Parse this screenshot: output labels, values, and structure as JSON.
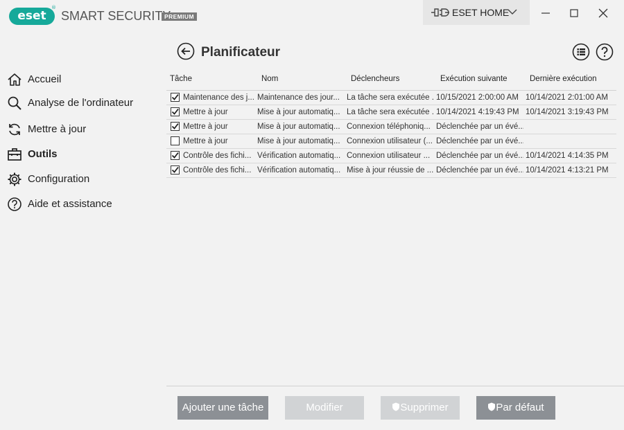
{
  "app": {
    "logo": "eset",
    "product": "SMART SECURITY",
    "badge": "PREMIUM",
    "home_label": "ESET HOME"
  },
  "sidebar": {
    "items": [
      {
        "label": "Accueil",
        "icon": "home-icon"
      },
      {
        "label": "Analyse de l'ordinateur",
        "icon": "search-icon"
      },
      {
        "label": "Mettre à jour",
        "icon": "refresh-icon"
      },
      {
        "label": "Outils",
        "icon": "toolbox-icon",
        "active": true
      },
      {
        "label": "Configuration",
        "icon": "gear-icon"
      },
      {
        "label": "Aide et assistance",
        "icon": "help-icon"
      }
    ]
  },
  "page": {
    "title": "Planificateur"
  },
  "table": {
    "headers": [
      "Tâche",
      "Nom",
      "Déclencheurs",
      "Exécution suivante",
      "Dernière exécution"
    ],
    "rows": [
      {
        "checked": true,
        "task": "Maintenance des j...",
        "name": "Maintenance des jour...",
        "trigger": "La tâche sera exécutée ...",
        "next": "10/15/2021 2:00:00 AM",
        "last": "10/14/2021 2:01:00 AM"
      },
      {
        "checked": true,
        "task": "Mettre à jour",
        "name": "Mise à jour automatiq...",
        "trigger": "La tâche sera exécutée ...",
        "next": "10/14/2021 4:19:43 PM",
        "last": "10/14/2021 3:19:43 PM"
      },
      {
        "checked": true,
        "task": "Mettre à jour",
        "name": "Mise à jour automatiq...",
        "trigger": "Connexion téléphoniq...",
        "next": "Déclenchée par un évé...",
        "last": ""
      },
      {
        "checked": false,
        "task": "Mettre à jour",
        "name": "Mise à jour automatiq...",
        "trigger": "Connexion utilisateur (...",
        "next": "Déclenchée par un évé...",
        "last": ""
      },
      {
        "checked": true,
        "task": "Contrôle des fichi...",
        "name": "Vérification automatiq...",
        "trigger": "Connexion utilisateur ...",
        "next": "Déclenchée par un évé...",
        "last": "10/14/2021 4:14:35 PM"
      },
      {
        "checked": true,
        "task": "Contrôle des fichi...",
        "name": "Vérification automatiq...",
        "trigger": "Mise à jour réussie de ...",
        "next": "Déclenchée par un évé...",
        "last": "10/14/2021 4:13:21 PM"
      }
    ]
  },
  "buttons": {
    "add": "Ajouter une tâche",
    "edit": "Modifier",
    "delete": "Supprimer",
    "default": "Par défaut"
  },
  "colors": {
    "brand": "#16a99a",
    "button_enabled": "#8c9095",
    "button_disabled": "#d1d3d5"
  }
}
